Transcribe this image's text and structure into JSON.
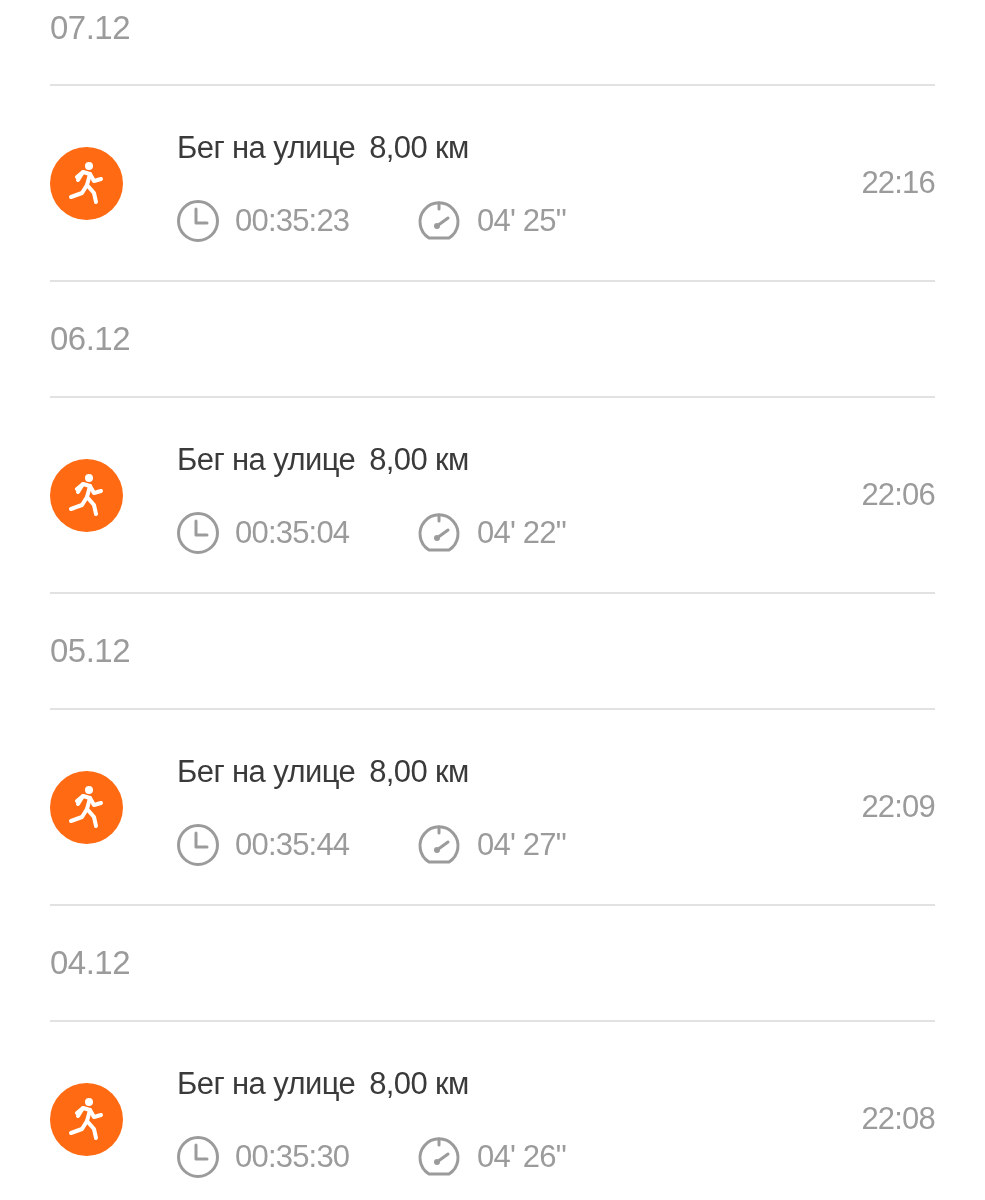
{
  "days": [
    {
      "date": "07.12",
      "workouts": [
        {
          "activity": "Бег на улице",
          "distance": "8,00 км",
          "duration": "00:35:23",
          "pace": "04' 25\"",
          "time": "22:16"
        }
      ]
    },
    {
      "date": "06.12",
      "workouts": [
        {
          "activity": "Бег на улице",
          "distance": "8,00 км",
          "duration": "00:35:04",
          "pace": "04' 22\"",
          "time": "22:06"
        }
      ]
    },
    {
      "date": "05.12",
      "workouts": [
        {
          "activity": "Бег на улице",
          "distance": "8,00 км",
          "duration": "00:35:44",
          "pace": "04' 27\"",
          "time": "22:09"
        }
      ]
    },
    {
      "date": "04.12",
      "workouts": [
        {
          "activity": "Бег на улице",
          "distance": "8,00 км",
          "duration": "00:35:30",
          "pace": "04' 26\"",
          "time": "22:08"
        }
      ]
    }
  ]
}
